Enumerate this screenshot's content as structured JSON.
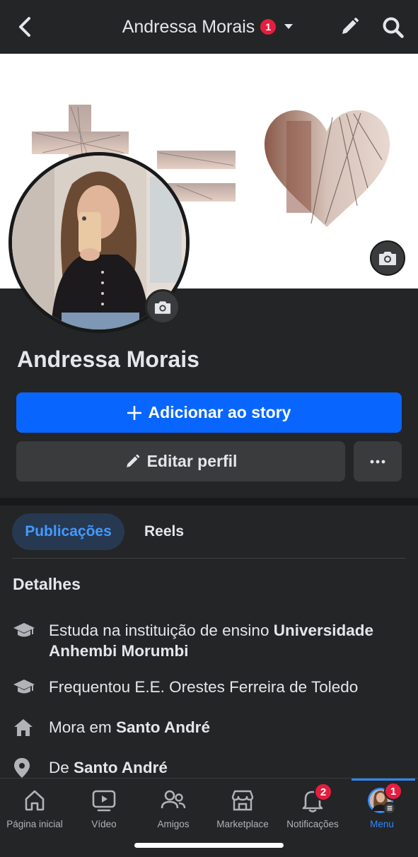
{
  "header": {
    "title": "Andressa Morais",
    "title_badge": "1",
    "icons": [
      "chevron-left-icon",
      "caret-down-icon",
      "pencil-icon",
      "search-icon"
    ]
  },
  "profile": {
    "name": "Andressa Morais",
    "add_story_label": "Adicionar ao story",
    "edit_profile_label": "Editar perfil",
    "more_label": "..."
  },
  "tabs": [
    {
      "label": "Publicações",
      "active": true
    },
    {
      "label": "Reels",
      "active": false
    }
  ],
  "details": {
    "title": "Detalhes",
    "items": [
      {
        "icon": "graduation-cap-icon",
        "prefix": "Estuda na instituição de ensino ",
        "bold": "Universidade Anhembi Morumbi"
      },
      {
        "icon": "graduation-cap-icon",
        "prefix": "Frequentou E.E. Orestes Ferreira de Toledo",
        "bold": ""
      },
      {
        "icon": "home-icon",
        "prefix": "Mora em ",
        "bold": "Santo André"
      },
      {
        "icon": "location-pin-icon",
        "prefix": "De ",
        "bold": "Santo André"
      }
    ]
  },
  "bottom_nav": {
    "items": [
      {
        "label": "Página inicial",
        "icon": "home-outline-icon",
        "badge": ""
      },
      {
        "label": "Vídeo",
        "icon": "video-icon",
        "badge": ""
      },
      {
        "label": "Amigos",
        "icon": "friends-icon",
        "badge": ""
      },
      {
        "label": "Marketplace",
        "icon": "marketplace-icon",
        "badge": ""
      },
      {
        "label": "Notificações",
        "icon": "bell-icon",
        "badge": "2"
      },
      {
        "label": "Menu",
        "icon": "avatar-menu-icon",
        "badge": "1",
        "active": true
      }
    ]
  },
  "colors": {
    "background": "#242526",
    "primary_button": "#0866ff",
    "secondary_button": "#3a3b3c",
    "badge": "#e41e3f",
    "active_tab_bg": "#263951",
    "active_tab_text": "#4599ff",
    "active_nav": "#2d88ff"
  }
}
